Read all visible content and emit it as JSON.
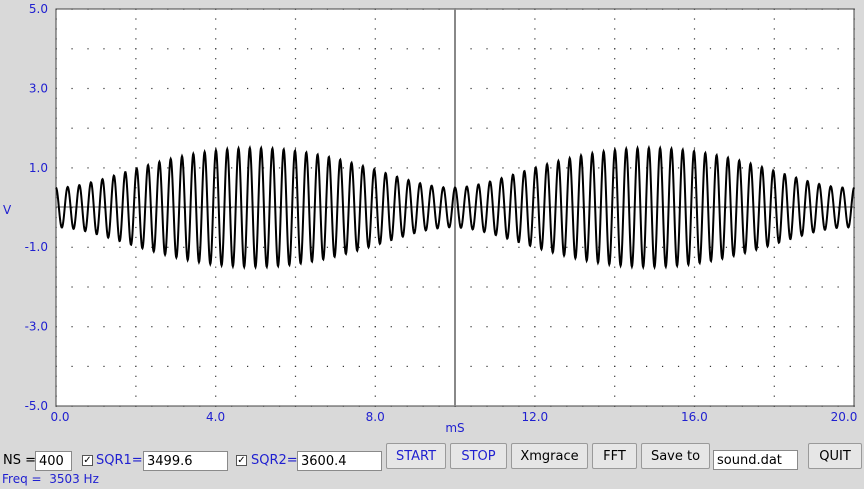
{
  "plot": {
    "y_axis_label": "V",
    "x_axis_label": "mS",
    "y_ticks": [
      "5.0",
      "3.0",
      "1.0",
      "-1.0",
      "-3.0",
      "-5.0"
    ],
    "x_ticks": [
      "0.0",
      "4.0",
      "8.0",
      "12.0",
      "16.0",
      "20.0"
    ],
    "colors": {
      "label": "#1f1fd0",
      "trace": "#000000",
      "grid_dots": "#333333",
      "plot_bg": "#ffffff"
    }
  },
  "chart_data": {
    "type": "line",
    "xlabel": "mS",
    "ylabel": "V",
    "xlim": [
      0,
      20
    ],
    "ylim": [
      -5,
      5
    ],
    "grid": true,
    "cursor_x": 10,
    "series": [
      {
        "components_hz": [
          3499.6,
          3600.4
        ],
        "beat_envelope_min": 0.5,
        "beat_envelope_max": 1.5,
        "envelope_peak_ms": [
          6.4,
          16.4
        ],
        "envelope_trough_ms": [
          1.4,
          11.4
        ]
      }
    ]
  },
  "controls": {
    "ns_label": "NS =",
    "ns_value": "400",
    "sqr1_label": "SQR1=",
    "sqr1_value": "3499.6",
    "sqr1_checked": "✓",
    "sqr2_label": "SQR2=",
    "sqr2_value": "3600.4",
    "sqr2_checked": "✓",
    "start_label": "START",
    "stop_label": "STOP",
    "xmgrace_label": "Xmgrace",
    "fft_label": "FFT",
    "save_label": "Save to",
    "filename_value": "sound.dat",
    "quit_label": "QUIT"
  },
  "status": {
    "freq_text": "Freq =  3503 Hz"
  }
}
